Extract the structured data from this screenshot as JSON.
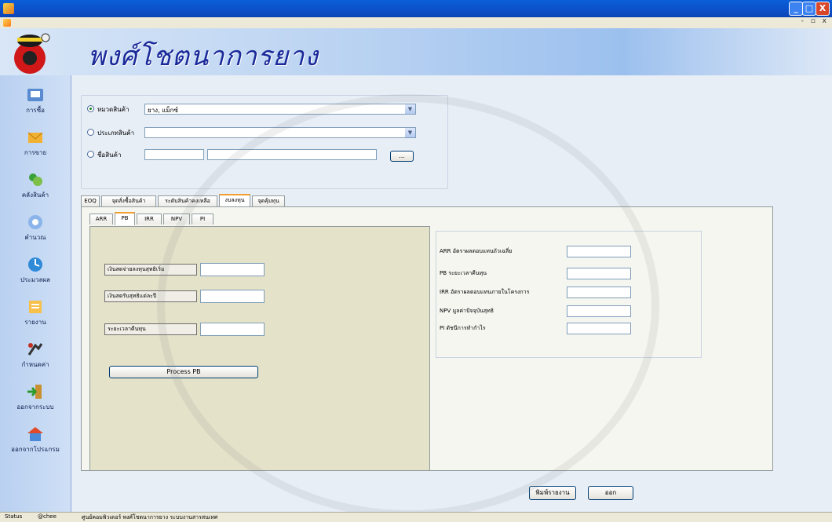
{
  "window": {
    "minimize": "_",
    "maximize": "□",
    "close": "X",
    "mdi_controls": "- ▫ x"
  },
  "banner": {
    "shop_name": "พงศ์โชตนาการยาง"
  },
  "sidebar": {
    "items": [
      {
        "label": "การซื้อ",
        "icon": "purchase-icon"
      },
      {
        "label": "การขาย",
        "icon": "sales-icon"
      },
      {
        "label": "คลังสินค้า",
        "icon": "warehouse-icon"
      },
      {
        "label": "คำนวณ",
        "icon": "calculate-icon"
      },
      {
        "label": "ประมวลผล",
        "icon": "process-icon"
      },
      {
        "label": "รายงาน",
        "icon": "report-icon"
      },
      {
        "label": "กำหนดค่า",
        "icon": "settings-icon"
      },
      {
        "label": "ออกจากระบบ",
        "icon": "logout-icon"
      },
      {
        "label": "ออกจากโปรแกรม",
        "icon": "exit-icon"
      }
    ]
  },
  "filter": {
    "category_label": "หมวดสินค้า",
    "category_value": "ยาง, แม็กซ์",
    "type_label": "ประเภทสินค้า",
    "type_value": "",
    "product_label": "ชื่อสินค้า",
    "browse_label": "..."
  },
  "tabs": [
    "EOQ",
    "จุดสั่งซื้อสินค้า",
    "ระดับสินค้าคงเหลือ",
    "งบลงทุน",
    "จุดคุ้มทุน"
  ],
  "active_tab": "งบลงทุน",
  "inner_tabs": [
    "ARR",
    "PB",
    "IRR",
    "NPV",
    "PI"
  ],
  "active_inner_tab": "PB",
  "pb_form": {
    "initial_investment_label": "เงินสดจ่ายลงทุนสุทธิเริ่ม",
    "annual_cashflow_label": "เงินสดรับสุทธิแต่ละปี",
    "payback_label": "ระยะเวลาคืนทุน",
    "process_button": "Process PB"
  },
  "results": {
    "arr_label": "ARR อัตราผลตอบแทนถัวเฉลี่ย",
    "pb_label": "PB ระยะเวลาคืนทุน",
    "irr_label": "IRR อัตราผลตอบแทนภายในโครงการ",
    "npv_label": "NPV มูลค่าปัจจุบันสุทธิ",
    "pi_label": "PI ดัชนีการทำกำไร"
  },
  "buttons": {
    "print": "พิมพ์รายงาน",
    "exit": "ออก"
  },
  "status": {
    "label": "Status",
    "user": "@chee",
    "credit": "ศูนย์คอมพิวเตอร์ พงศ์โชตนาการยาง ระบบงานสารสนเทศ"
  },
  "colors": {
    "titlebar": "#0b4fc8",
    "accent_tab": "#f0a030",
    "shop_name": "#1a2a9a"
  }
}
